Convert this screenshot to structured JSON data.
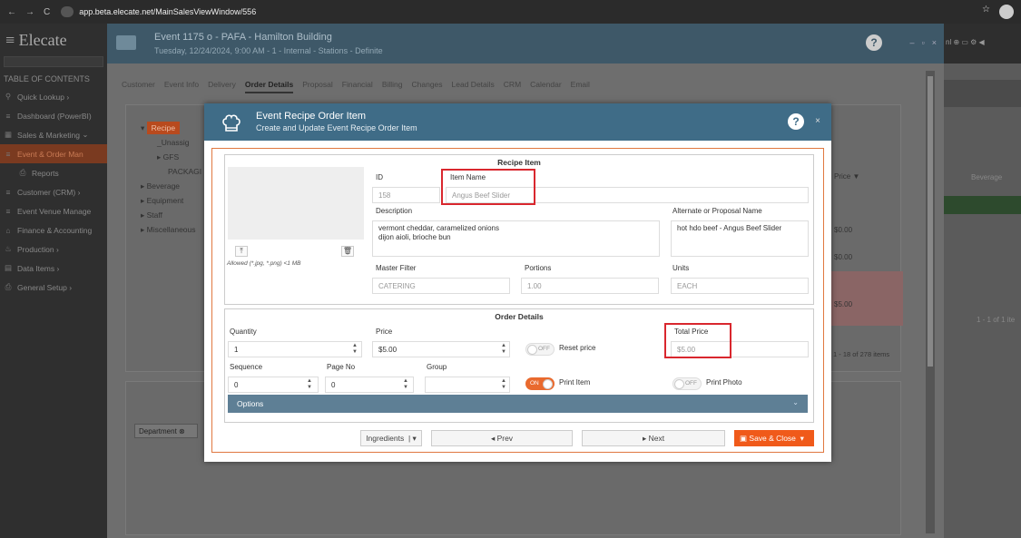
{
  "browser": {
    "url": "app.beta.elecate.net/MainSalesViewWindow/556"
  },
  "app": {
    "logo": "Elecate",
    "toc_label": "TABLE OF CONTENTS",
    "sidebar": [
      {
        "label": "Quick Lookup",
        "icon": "search-icon"
      },
      {
        "label": "Dashboard (PowerBI)",
        "icon": "menu-icon"
      },
      {
        "label": "Sales & Marketing",
        "icon": "calendar-icon"
      },
      {
        "label": "Event & Order Man",
        "icon": "menu-icon"
      },
      {
        "label": "Reports",
        "icon": "printer-icon"
      },
      {
        "label": "Customer (CRM)",
        "icon": "menu-icon"
      },
      {
        "label": "Event Venue Manage",
        "icon": "menu-icon"
      },
      {
        "label": "Finance & Accounting",
        "icon": "bank-icon"
      },
      {
        "label": "Production",
        "icon": "chef-icon"
      },
      {
        "label": "Data Items",
        "icon": "grid-icon"
      },
      {
        "label": "General Setup",
        "icon": "printer-icon"
      }
    ]
  },
  "window": {
    "title": "Event 1175 o - PAFA - Hamilton Building",
    "subtitle": "Tuesday, 12/24/2024, 9:00 AM - 1 - Internal - Stations - Definite",
    "tabs": [
      "Customer",
      "Event Info",
      "Delivery",
      "Order Details",
      "Proposal",
      "Financial",
      "Billing",
      "Changes",
      "Lead Details",
      "CRM",
      "Calendar",
      "Email"
    ],
    "active_tab": "Order Details",
    "tree": [
      "Recipe",
      "_Unassig",
      "GFS",
      "PACKAGI",
      "Beverage",
      "Equipment",
      "Staff",
      "Miscellaneous"
    ],
    "grid_header": "Price",
    "grid_prices": [
      "$0.00",
      "$0.00",
      "$5.00"
    ],
    "paging": "1 - 18 of 278 items",
    "department_chip": "Department",
    "right_header": "Beverage",
    "right_paging": "1 - 1 of 1 ite"
  },
  "dialog": {
    "title": "Event Recipe Order Item",
    "subtitle": "Create and Update Event Recipe Order Item",
    "recipe_section": "Recipe Item",
    "image_hint": "Allowed (*.jpg, *.png) <1 MB",
    "id_label": "ID",
    "id_value": "158",
    "item_name_label": "Item Name",
    "item_name_value": "Angus Beef Slider",
    "description_label": "Description",
    "description_value": "vermont cheddar, caramelized onions\ndijon aioli, brioche bun",
    "alt_name_label": "Alternate or Proposal Name",
    "alt_name_value": "hot hdo beef - Angus Beef Slider",
    "master_filter_label": "Master Filter",
    "master_filter_value": "CATERING",
    "portions_label": "Portions",
    "portions_value": "1.00",
    "units_label": "Units",
    "units_value": "EACH",
    "order_section": "Order Details",
    "quantity_label": "Quantity",
    "quantity_value": "1",
    "price_label": "Price",
    "price_value": "$5.00",
    "reset_price_label": "Reset price",
    "reset_toggle": "OFF",
    "total_price_label": "Total Price",
    "total_price_value": "$5.00",
    "sequence_label": "Sequence",
    "sequence_value": "0",
    "page_no_label": "Page No",
    "page_no_value": "0",
    "group_label": "Group",
    "print_item_label": "Print Item",
    "print_item_toggle": "ON",
    "print_photo_label": "Print Photo",
    "print_photo_toggle": "OFF",
    "options_label": "Options",
    "ingredients_label": "Ingredients",
    "prev_label": "Prev",
    "next_label": "Next",
    "save_close_label": "Save & Close"
  },
  "colors": {
    "accent": "#f05a1a",
    "header": "#3f6c87",
    "highlight": "#d9272e"
  }
}
